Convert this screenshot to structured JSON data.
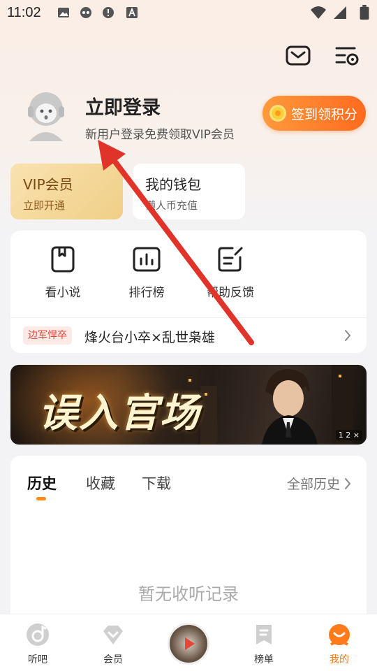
{
  "status_bar": {
    "time": "11:02"
  },
  "colors": {
    "accent": "#ff7a1a",
    "arrow": "#e0332a",
    "vip_gold": "#f0cf87",
    "tag_red": "#e2483a"
  },
  "header": {
    "mail_icon": "mail-icon",
    "settings_icon": "list-settings-icon"
  },
  "profile": {
    "title": "立即登录",
    "subtitle": "新用户登录免费领取VIP会员",
    "signin_label": "签到领积分"
  },
  "cards": {
    "vip": {
      "title": "VIP会员",
      "subtitle": "立即开通"
    },
    "wallet": {
      "title": "我的钱包",
      "subtitle": "懒人币充值"
    }
  },
  "tools": [
    {
      "label": "看小说",
      "icon": "book-icon"
    },
    {
      "label": "排行榜",
      "icon": "chart-icon"
    },
    {
      "label": "帮助反馈",
      "icon": "feedback-edit-icon"
    }
  ],
  "recommend": {
    "tag": "边军悍卒",
    "title": "烽火台小卒×乱世枭雄"
  },
  "banner": {
    "title": "误入官场",
    "ad_label": "1 2 ×"
  },
  "history": {
    "tabs": [
      "历史",
      "收藏",
      "下载"
    ],
    "all_label": "全部历史",
    "empty_text": "暂无收听记录"
  },
  "nav": [
    {
      "label": "听吧",
      "icon": "listen-icon"
    },
    {
      "label": "会员",
      "icon": "diamond-icon"
    },
    {
      "label": "",
      "icon": "center-player-icon"
    },
    {
      "label": "榜单",
      "icon": "ranking-icon"
    },
    {
      "label": "我的",
      "icon": "profile-icon"
    }
  ]
}
